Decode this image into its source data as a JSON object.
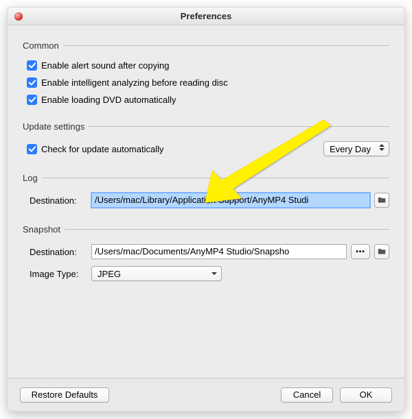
{
  "window": {
    "title": "Preferences"
  },
  "common": {
    "legend": "Common",
    "opt1": {
      "label": "Enable alert sound after copying",
      "checked": true
    },
    "opt2": {
      "label": "Enable intelligent analyzing before reading disc",
      "checked": true
    },
    "opt3": {
      "label": "Enable loading DVD automatically",
      "checked": true
    }
  },
  "update": {
    "legend": "Update settings",
    "opt": {
      "label": "Check for update automatically",
      "checked": true
    },
    "frequency_selected": "Every Day"
  },
  "log": {
    "legend": "Log",
    "destination_label": "Destination:",
    "destination_value": "/Users/mac/Library/Application Support/AnyMP4 Studi"
  },
  "snapshot": {
    "legend": "Snapshot",
    "destination_label": "Destination:",
    "destination_value": "/Users/mac/Documents/AnyMP4 Studio/Snapsho",
    "image_type_label": "Image Type:",
    "image_type_selected": "JPEG"
  },
  "buttons": {
    "restore": "Restore Defaults",
    "cancel": "Cancel",
    "ok": "OK"
  },
  "ellipsis": "•••"
}
